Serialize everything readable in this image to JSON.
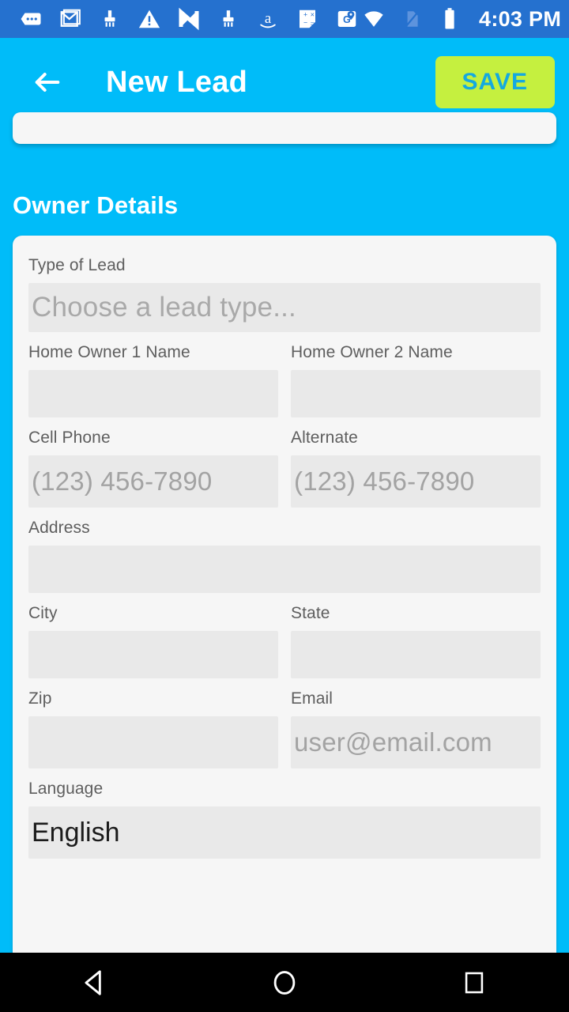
{
  "status_bar": {
    "time": "4:03 PM",
    "icons": [
      {
        "name": "messages-icon"
      },
      {
        "name": "gmail-icon"
      },
      {
        "name": "cleaner-brush-icon"
      },
      {
        "name": "warning-triangle-icon"
      },
      {
        "name": "nova-launcher-icon"
      },
      {
        "name": "cleaner-brush-icon-2"
      },
      {
        "name": "amazon-icon"
      },
      {
        "name": "calculator-icon"
      },
      {
        "name": "google-maps-icon"
      }
    ],
    "right_icons": [
      {
        "name": "wifi-icon"
      },
      {
        "name": "no-sim-icon"
      },
      {
        "name": "battery-icon"
      }
    ]
  },
  "app_bar": {
    "back_label": "Back",
    "title": "New Lead",
    "save_label": "SAVE"
  },
  "section": {
    "title": "Owner Details"
  },
  "form": {
    "lead_type": {
      "label": "Type of Lead",
      "placeholder": "Choose a lead type...",
      "value": ""
    },
    "home_owner_1": {
      "label": "Home Owner 1 Name",
      "placeholder": "",
      "value": ""
    },
    "home_owner_2": {
      "label": "Home Owner 2 Name",
      "placeholder": "",
      "value": ""
    },
    "cell_phone": {
      "label": "Cell Phone",
      "placeholder": "(123) 456-7890",
      "value": ""
    },
    "alternate": {
      "label": "Alternate",
      "placeholder": "(123) 456-7890",
      "value": ""
    },
    "address": {
      "label": "Address",
      "placeholder": "",
      "value": ""
    },
    "city": {
      "label": "City",
      "placeholder": "",
      "value": ""
    },
    "state": {
      "label": "State",
      "placeholder": "",
      "value": ""
    },
    "zip": {
      "label": "Zip",
      "placeholder": "",
      "value": ""
    },
    "email": {
      "label": "Email",
      "placeholder": "user@email.com",
      "value": ""
    },
    "language": {
      "label": "Language",
      "placeholder": "",
      "value": "English"
    }
  },
  "nav_bar": {
    "back": "back-nav",
    "home": "home-nav",
    "recents": "recents-nav"
  },
  "colors": {
    "app_blue": "#00bcf9",
    "status_blue": "#2571cf",
    "save_green": "#c5f03f",
    "save_text": "#14a9e0",
    "card_bg": "#f6f6f6",
    "input_bg": "#e9e9e9",
    "label_gray": "#5e5e5e",
    "placeholder_gray": "#a3a3a3"
  }
}
